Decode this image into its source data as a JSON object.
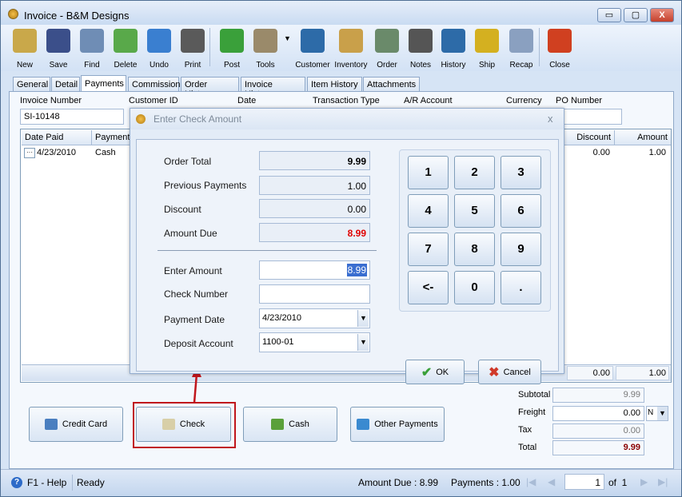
{
  "window": {
    "title": "Invoice - B&M Designs",
    "minimize": "▭",
    "maximize": "▢",
    "close": "X"
  },
  "toolbar": [
    {
      "label": "New",
      "icon": "new-icon",
      "color": "#c9a84a"
    },
    {
      "label": "Save",
      "icon": "save-icon",
      "color": "#3b4f8a"
    },
    {
      "label": "Find",
      "icon": "find-icon",
      "color": "#6f8db5"
    },
    {
      "label": "Delete",
      "icon": "delete-icon",
      "color": "#59a94a"
    },
    {
      "label": "Undo",
      "icon": "undo-icon",
      "color": "#3a7fd0"
    },
    {
      "label": "Print",
      "icon": "print-icon",
      "color": "#5a5a5a"
    },
    {
      "label": "Post",
      "icon": "post-icon",
      "color": "#3aa03a"
    },
    {
      "label": "Tools",
      "icon": "tools-icon",
      "color": "#9a8a6a"
    },
    {
      "label": "Customer",
      "icon": "customer-icon",
      "color": "#2d6ba8"
    },
    {
      "label": "Inventory",
      "icon": "inventory-icon",
      "color": "#c9a04a"
    },
    {
      "label": "Order",
      "icon": "order-icon",
      "color": "#6a8a6a"
    },
    {
      "label": "Notes",
      "icon": "notes-icon",
      "color": "#555555"
    },
    {
      "label": "History",
      "icon": "history-icon",
      "color": "#2d6ba8"
    },
    {
      "label": "Ship",
      "icon": "ship-icon",
      "color": "#d4b020"
    },
    {
      "label": "Recap",
      "icon": "recap-icon",
      "color": "#8aa0c0"
    },
    {
      "label": "Close",
      "icon": "close-icon",
      "color": "#d04020"
    }
  ],
  "tabs": [
    "General",
    "Detail",
    "Payments",
    "Commission",
    "Order History",
    "Invoice History",
    "Item History",
    "Attachments"
  ],
  "header": {
    "invoice_number_label": "Invoice Number",
    "invoice_number": "SI-10148",
    "customer_id_label": "Customer ID",
    "date_label": "Date",
    "transaction_type_label": "Transaction Type",
    "ar_account_label": "A/R Account",
    "currency_label": "Currency",
    "po_number_label": "PO Number"
  },
  "grid": {
    "columns": [
      "Date Paid",
      "Payment",
      "Discount",
      "Amount"
    ],
    "rows": [
      {
        "date_paid": "4/23/2010",
        "payment": "Cash",
        "discount": "0.00",
        "amount": "1.00"
      }
    ],
    "footer": {
      "discount": "0.00",
      "amount": "1.00"
    }
  },
  "payment_buttons": [
    "Credit Card",
    "Check",
    "Cash",
    "Other Payments"
  ],
  "totals": {
    "subtotal_label": "Subtotal",
    "subtotal": "9.99",
    "freight_label": "Freight",
    "freight": "0.00",
    "freight_option": "N",
    "tax_label": "Tax",
    "tax": "0.00",
    "total_label": "Total",
    "total": "9.99"
  },
  "status": {
    "help": "F1 - Help",
    "state": "Ready",
    "amount_due": "Amount Due : 8.99",
    "payments": "Payments : 1.00",
    "page": "1",
    "of": "of  1"
  },
  "dialog": {
    "title": "Enter Check Amount",
    "close": "x",
    "order_total_label": "Order Total",
    "order_total": "9.99",
    "previous_payments_label": "Previous Payments",
    "previous_payments": "1.00",
    "discount_label": "Discount",
    "discount": "0.00",
    "amount_due_label": "Amount Due",
    "amount_due": "8.99",
    "enter_amount_label": "Enter Amount",
    "enter_amount": "8.99",
    "check_number_label": "Check Number",
    "check_number": "",
    "payment_date_label": "Payment Date",
    "payment_date": "4/23/2010",
    "deposit_account_label": "Deposit Account",
    "deposit_account": "1100-01",
    "keys": [
      "1",
      "2",
      "3",
      "4",
      "5",
      "6",
      "7",
      "8",
      "9",
      "<-",
      "0",
      "."
    ],
    "ok": "OK",
    "cancel": "Cancel"
  },
  "colors": {
    "accent_red": "#e00000",
    "highlight_box": "#c0161c",
    "selection": "#3a6ed0"
  }
}
